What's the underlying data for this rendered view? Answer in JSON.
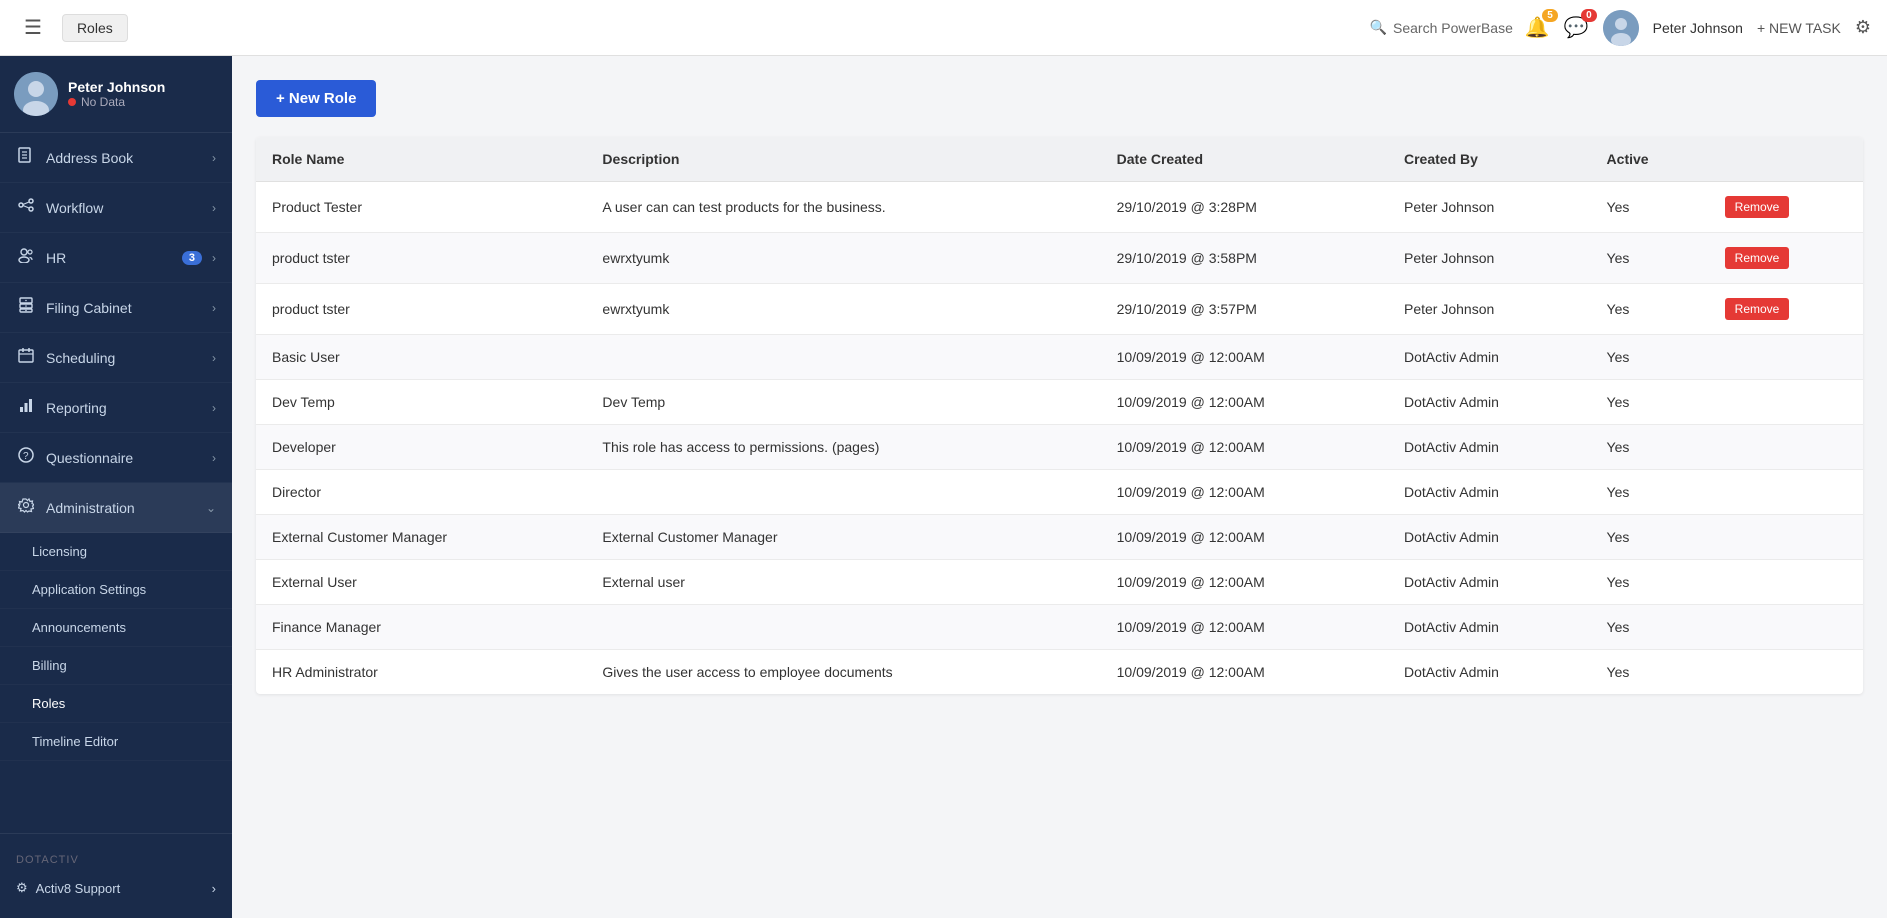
{
  "topbar": {
    "hamburger_label": "☰",
    "breadcrumb": "Roles",
    "search_placeholder": "Search PowerBase",
    "notification_count": "5",
    "message_count": "0",
    "username": "Peter Johnson",
    "new_task_label": "+ NEW TASK"
  },
  "sidebar": {
    "username": "Peter Johnson",
    "status": "No Data",
    "nav_items": [
      {
        "id": "address-book",
        "label": "Address Book",
        "icon": "📖",
        "has_chevron": true
      },
      {
        "id": "workflow",
        "label": "Workflow",
        "icon": "⚙",
        "has_chevron": true
      },
      {
        "id": "hr",
        "label": "HR",
        "icon": "👥",
        "has_chevron": true,
        "badge": "3"
      },
      {
        "id": "filing-cabinet",
        "label": "Filing Cabinet",
        "icon": "📁",
        "has_chevron": true
      },
      {
        "id": "scheduling",
        "label": "Scheduling",
        "icon": "📅",
        "has_chevron": true
      },
      {
        "id": "reporting",
        "label": "Reporting",
        "icon": "📊",
        "has_chevron": true
      },
      {
        "id": "questionnaire",
        "label": "Questionnaire",
        "icon": "❓",
        "has_chevron": true
      },
      {
        "id": "administration",
        "label": "Administration",
        "icon": "🔧",
        "has_chevron": true,
        "is_active": true
      }
    ],
    "subnav_items": [
      {
        "id": "licensing",
        "label": "Licensing"
      },
      {
        "id": "application-settings",
        "label": "Application Settings"
      },
      {
        "id": "announcements",
        "label": "Announcements"
      },
      {
        "id": "billing",
        "label": "Billing"
      },
      {
        "id": "roles",
        "label": "Roles",
        "is_active": true
      },
      {
        "id": "timeline-editor",
        "label": "Timeline Editor"
      }
    ],
    "dotactiv_label": "DOTACTIV",
    "support_label": "Activ8 Support"
  },
  "content": {
    "new_role_label": "+ New Role",
    "table": {
      "headers": [
        "Role Name",
        "Description",
        "Date Created",
        "Created By",
        "Active"
      ],
      "rows": [
        {
          "role_name": "Product Tester",
          "description": "A user can can test products for the business.",
          "date_created": "29/10/2019 @ 3:28PM",
          "created_by": "Peter Johnson",
          "active": "Yes",
          "show_remove": true
        },
        {
          "role_name": "product tster",
          "description": "ewrxtyumk",
          "date_created": "29/10/2019 @ 3:58PM",
          "created_by": "Peter Johnson",
          "active": "Yes",
          "show_remove": true
        },
        {
          "role_name": "product tster",
          "description": "ewrxtyumk",
          "date_created": "29/10/2019 @ 3:57PM",
          "created_by": "Peter Johnson",
          "active": "Yes",
          "show_remove": true
        },
        {
          "role_name": "Basic User",
          "description": "",
          "date_created": "10/09/2019 @ 12:00AM",
          "created_by": "DotActiv Admin",
          "active": "Yes",
          "show_remove": false
        },
        {
          "role_name": "Dev Temp",
          "description": "Dev Temp",
          "date_created": "10/09/2019 @ 12:00AM",
          "created_by": "DotActiv Admin",
          "active": "Yes",
          "show_remove": false
        },
        {
          "role_name": "Developer",
          "description": "This role has access to permissions. (pages)",
          "date_created": "10/09/2019 @ 12:00AM",
          "created_by": "DotActiv Admin",
          "active": "Yes",
          "show_remove": false
        },
        {
          "role_name": "Director",
          "description": "",
          "date_created": "10/09/2019 @ 12:00AM",
          "created_by": "DotActiv Admin",
          "active": "Yes",
          "show_remove": false
        },
        {
          "role_name": "External Customer Manager",
          "description": "External Customer Manager",
          "date_created": "10/09/2019 @ 12:00AM",
          "created_by": "DotActiv Admin",
          "active": "Yes",
          "show_remove": false
        },
        {
          "role_name": "External User",
          "description": "External user",
          "date_created": "10/09/2019 @ 12:00AM",
          "created_by": "DotActiv Admin",
          "active": "Yes",
          "show_remove": false
        },
        {
          "role_name": "Finance Manager",
          "description": "",
          "date_created": "10/09/2019 @ 12:00AM",
          "created_by": "DotActiv Admin",
          "active": "Yes",
          "show_remove": false
        },
        {
          "role_name": "HR Administrator",
          "description": "Gives the user access to employee documents",
          "date_created": "10/09/2019 @ 12:00AM",
          "created_by": "DotActiv Admin",
          "active": "Yes",
          "show_remove": false
        }
      ],
      "remove_label": "Remove"
    }
  }
}
